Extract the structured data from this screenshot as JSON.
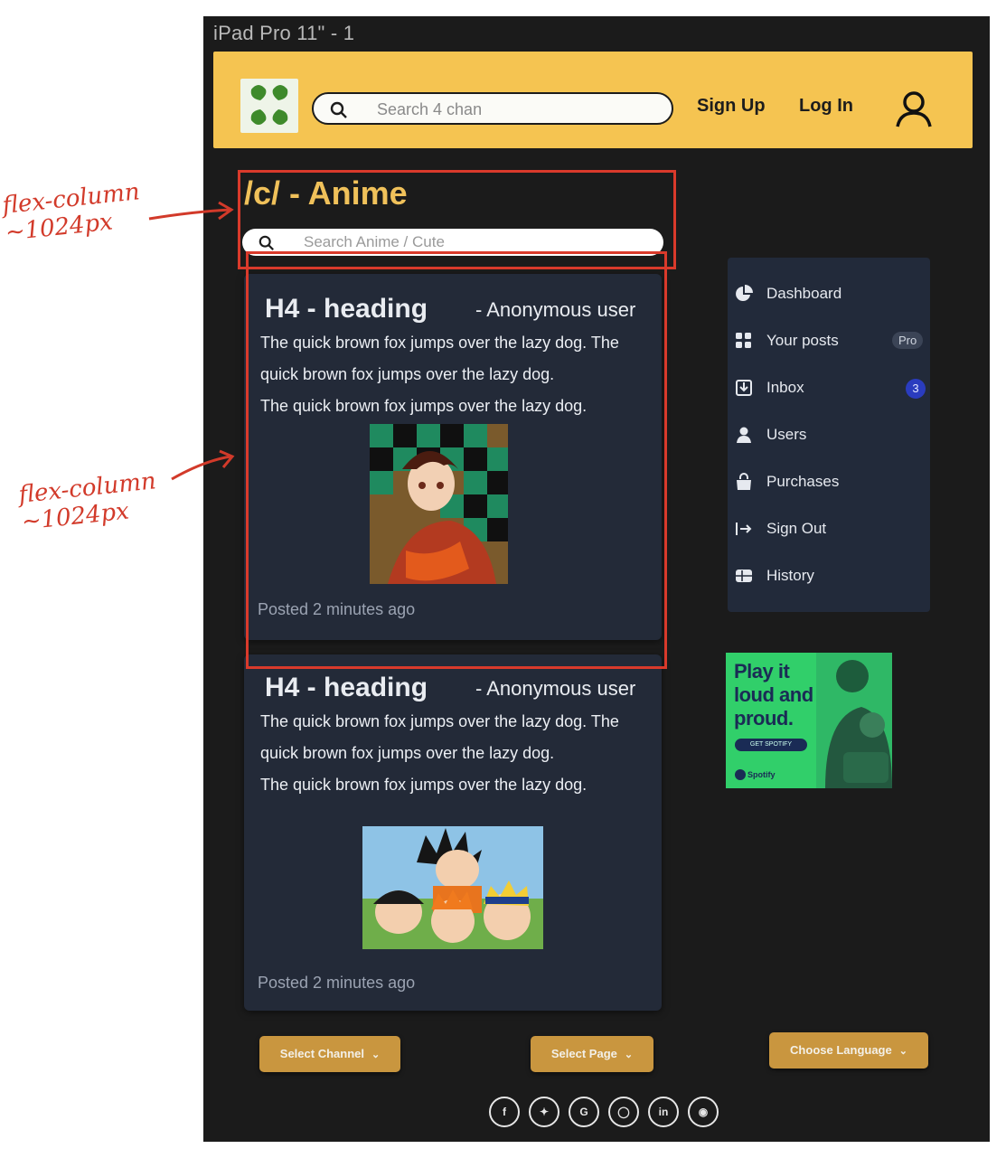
{
  "frame": {
    "title": "iPad Pro 11\" - 1"
  },
  "header": {
    "search_placeholder": "Search 4 chan",
    "signup": "Sign Up",
    "login": "Log In"
  },
  "board": {
    "title": "/c/ - Anime",
    "search_placeholder": "Search Anime / Cute"
  },
  "posts": [
    {
      "heading": "H4 - heading",
      "author": "- Anonymous user",
      "body_line1": "The quick brown fox jumps over the lazy dog. The quick brown fox jumps over the lazy dog.",
      "body_line2": "The quick brown fox jumps over the lazy dog.",
      "posted": "Posted 2 minutes ago"
    },
    {
      "heading": "H4 - heading",
      "author": "- Anonymous user",
      "body_line1": "The quick brown fox jumps over the lazy dog. The quick brown fox jumps over the lazy dog.",
      "body_line2": "The quick brown fox jumps over the lazy dog.",
      "posted": "Posted 2 minutes ago"
    }
  ],
  "sidebar": {
    "items": [
      {
        "label": "Dashboard",
        "icon": "pie-chart-icon"
      },
      {
        "label": "Your posts",
        "icon": "grid-icon",
        "badge": "Pro"
      },
      {
        "label": "Inbox",
        "icon": "inbox-icon",
        "badge": "3"
      },
      {
        "label": "Users",
        "icon": "user-icon"
      },
      {
        "label": "Purchases",
        "icon": "shopping-bag-icon"
      },
      {
        "label": "Sign Out",
        "icon": "sign-out-icon"
      },
      {
        "label": "History",
        "icon": "table-icon"
      }
    ]
  },
  "ad": {
    "headline": "Play it loud and proud.",
    "cta": "GET SPOTIFY",
    "brand": "Spotify"
  },
  "footer": {
    "select_channel": "Select Channel",
    "select_page": "Select Page",
    "choose_language": "Choose Language",
    "socials": [
      "facebook-icon",
      "twitter-icon",
      "google-icon",
      "instagram-icon",
      "linkedin-icon",
      "github-icon"
    ]
  },
  "annotations": {
    "note1": "flex-column\n~1024px",
    "note2": "flex-column\n~1024px"
  },
  "colors": {
    "header_bg": "#f5c451",
    "accent_gold": "#f0c15a",
    "card_bg": "#232a38",
    "annotation_red": "#d93a2b"
  }
}
